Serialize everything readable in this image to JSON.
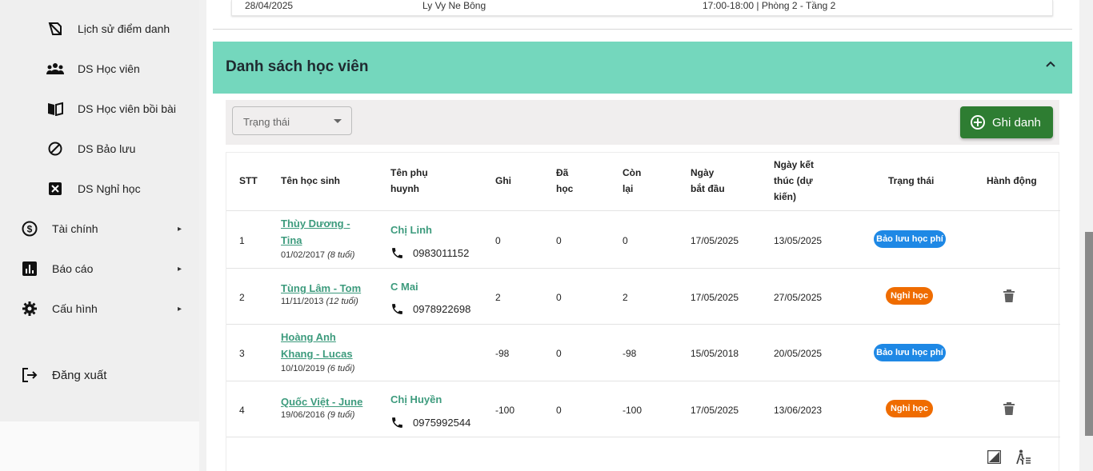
{
  "sidebar": {
    "items": [
      {
        "label": "Lịch sử điểm danh",
        "icon": "history-attendance-icon"
      },
      {
        "label": "DS Học viên",
        "icon": "people-icon"
      },
      {
        "label": "DS Học viên bồi bài",
        "icon": "book-icon"
      },
      {
        "label": "DS Bảo lưu",
        "icon": "block-icon"
      },
      {
        "label": "DS Nghỉ học",
        "icon": "close-box-icon"
      },
      {
        "label": "Tài chính",
        "icon": "dollar-circle-icon"
      },
      {
        "label": "Báo cáo",
        "icon": "bar-chart-icon"
      },
      {
        "label": "Cấu hình",
        "icon": "gear-icon"
      },
      {
        "label": "Đăng xuất",
        "icon": "logout-icon"
      }
    ]
  },
  "schedule_row": {
    "date": "28/04/2025",
    "teacher": "Ly Vy Ne Bông",
    "time_room": "17:00-18:00 | Phòng 2 - Tầng 2"
  },
  "section": {
    "title": "Danh sách học viên"
  },
  "filter": {
    "status_placeholder": "Trạng thái",
    "enroll_label": "Ghi danh"
  },
  "table": {
    "headers": {
      "stt": "STT",
      "student": "Tên học sinh",
      "parent_1": "Tên phụ",
      "parent_2": "huynh",
      "registered": "Ghi",
      "studied_1": "Đã",
      "studied_2": "học",
      "remaining_1": "Còn",
      "remaining_2": "lại",
      "start_1": "Ngày",
      "start_2": "bắt đầu",
      "end_1": "Ngày kết",
      "end_2": "thúc (dự",
      "end_3": "kiến)",
      "status": "Trạng thái",
      "action": "Hành động"
    },
    "rows": [
      {
        "stt": "1",
        "name_1": "Thùy Dương -",
        "name_2": "Tina",
        "dob": "01/02/2017",
        "age": "(8 tuổi)",
        "parent": "Chị Linh",
        "phone": "0983011152",
        "registered": "0",
        "studied": "0",
        "remaining": "0",
        "start": "17/05/2025",
        "end": "13/05/2025",
        "status": "Bảo lưu học phí"
      },
      {
        "stt": "2",
        "name_1": "Tùng Lâm - Tom",
        "name_2": "",
        "dob": "11/11/2013",
        "age": "(12 tuổi)",
        "parent": "C Mai",
        "phone": "0978922698",
        "registered": "2",
        "studied": "0",
        "remaining": "2",
        "start": "17/05/2025",
        "end": "27/05/2025",
        "status": "Nghỉ học"
      },
      {
        "stt": "3",
        "name_1": "Hoàng Anh",
        "name_2": "Khang - Lucas",
        "dob": "10/10/2019",
        "age": "(6 tuổi)",
        "parent": "",
        "phone": "",
        "registered": "-98",
        "studied": "0",
        "remaining": "-98",
        "start": "15/05/2018",
        "end": "20/05/2025",
        "status": "Bảo lưu học phí"
      },
      {
        "stt": "4",
        "name_1": "Quốc Việt - June",
        "name_2": "",
        "dob": "19/06/2016",
        "age": "(9 tuổi)",
        "parent": "Chị Huyền",
        "phone": "0975992544",
        "registered": "-100",
        "studied": "0",
        "remaining": "-100",
        "start": "17/05/2025",
        "end": "13/06/2023",
        "status": "Nghỉ học"
      }
    ]
  },
  "colors": {
    "accent": "#74d7bd",
    "primary_button": "#2e7d32",
    "link": "#3d9b7d",
    "badge_blue": "#1e88e5",
    "badge_orange": "#ef6c00"
  }
}
